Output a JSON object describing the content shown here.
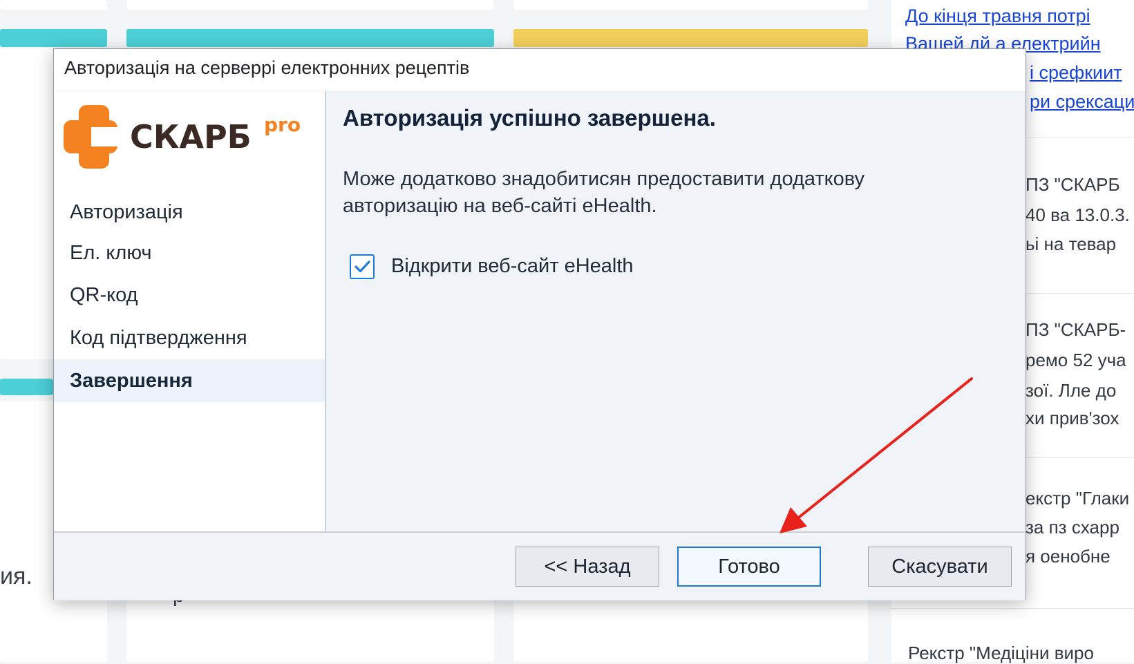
{
  "dialog": {
    "title": "Авторизація на серверрі електронних рецептів",
    "logo": {
      "text": "СКАРБ",
      "suffix": "pro",
      "icon": "skarb-logo-icon"
    },
    "nav": [
      {
        "label": "Авторизація",
        "active": false
      },
      {
        "label": "Ел. ключ",
        "active": false
      },
      {
        "label": "QR-код",
        "active": false
      },
      {
        "label": "Код підтвердження",
        "active": false
      },
      {
        "label": "Завершення",
        "active": true
      }
    ],
    "heading": "Авторизація успішно завершена.",
    "description": "Може додатково знадобитисян предоставити додаткову авторизацію на веб-сайті eHealth.",
    "checkbox": {
      "label": "Відкрити веб-сайт eHealth",
      "checked": true
    },
    "buttons": {
      "back": "<< Назад",
      "done": "Готово",
      "cancel": "Скасувати"
    }
  },
  "background": {
    "news_links": [
      "До кінця травня потрі",
      "Вашей дй а електрийн",
      "і срефкиит",
      "ри срексаци"
    ],
    "news_snippets": [
      "ПЗ \"СКАРБ",
      "40 ва 13.0.3.",
      "ьі на тевар",
      "ПЗ \"СКАРБ-",
      "ремо 52 уча",
      "зої. Лле до",
      "хи прив'зох",
      "екстр \"Глаки",
      "за пз схарр",
      "я оенобне",
      "Рекстр \"Медіціни виро"
    ],
    "left_text": "ия.",
    "left_fragment": "р"
  },
  "colors": {
    "accent": "#1e7ad8",
    "logo_orange": "#f58220",
    "logo_dark": "#3b2a23",
    "annotation_arrow": "#e8221b",
    "link_blue": "#1a46d6"
  }
}
